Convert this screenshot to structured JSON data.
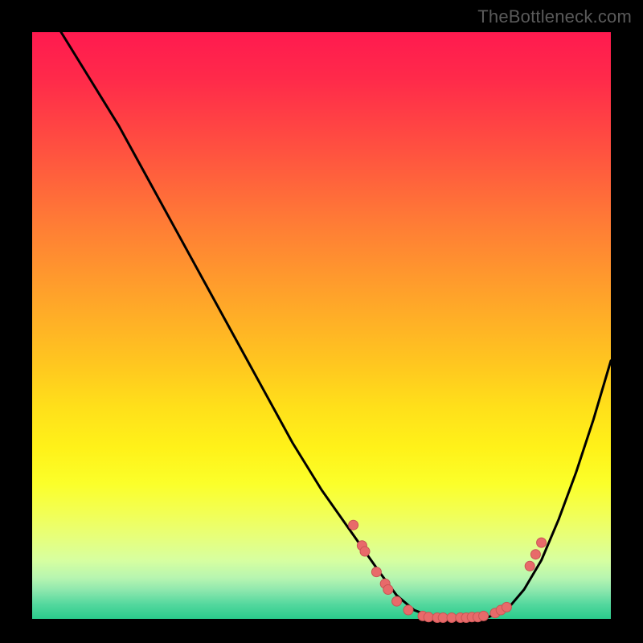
{
  "watermark": "TheBottleneck.com",
  "chart_data": {
    "type": "line",
    "title": "",
    "xlabel": "",
    "ylabel": "",
    "xlim": [
      0,
      100
    ],
    "ylim": [
      0,
      100
    ],
    "grid": false,
    "series": [
      {
        "name": "curve",
        "x": [
          0,
          5,
          10,
          15,
          20,
          25,
          30,
          35,
          40,
          45,
          50,
          55,
          60,
          63,
          66,
          70,
          74,
          78,
          82,
          85,
          88,
          91,
          94,
          97,
          100
        ],
        "y": [
          108,
          100,
          92,
          84,
          75,
          66,
          57,
          48,
          39,
          30,
          22,
          15,
          8,
          4,
          1.5,
          0,
          0,
          0,
          1.5,
          5,
          10,
          17,
          25,
          34,
          44
        ]
      }
    ],
    "markers": [
      {
        "x": 55.5,
        "y": 16.0
      },
      {
        "x": 57.0,
        "y": 12.5
      },
      {
        "x": 57.5,
        "y": 11.5
      },
      {
        "x": 59.5,
        "y": 8.0
      },
      {
        "x": 61.0,
        "y": 6.0
      },
      {
        "x": 61.5,
        "y": 5.0
      },
      {
        "x": 63.0,
        "y": 3.0
      },
      {
        "x": 65.0,
        "y": 1.5
      },
      {
        "x": 67.5,
        "y": 0.5
      },
      {
        "x": 68.5,
        "y": 0.3
      },
      {
        "x": 70.0,
        "y": 0.2
      },
      {
        "x": 71.0,
        "y": 0.2
      },
      {
        "x": 72.5,
        "y": 0.2
      },
      {
        "x": 74.0,
        "y": 0.2
      },
      {
        "x": 75.0,
        "y": 0.2
      },
      {
        "x": 76.0,
        "y": 0.3
      },
      {
        "x": 77.0,
        "y": 0.3
      },
      {
        "x": 78.0,
        "y": 0.5
      },
      {
        "x": 80.0,
        "y": 1.0
      },
      {
        "x": 81.0,
        "y": 1.5
      },
      {
        "x": 82.0,
        "y": 2.0
      },
      {
        "x": 86.0,
        "y": 9.0
      },
      {
        "x": 87.0,
        "y": 11.0
      },
      {
        "x": 88.0,
        "y": 13.0
      }
    ],
    "marker_radius": 6,
    "colors": {
      "curve": "#000000",
      "marker_fill": "#e86a6a",
      "marker_stroke": "#c95454"
    }
  }
}
